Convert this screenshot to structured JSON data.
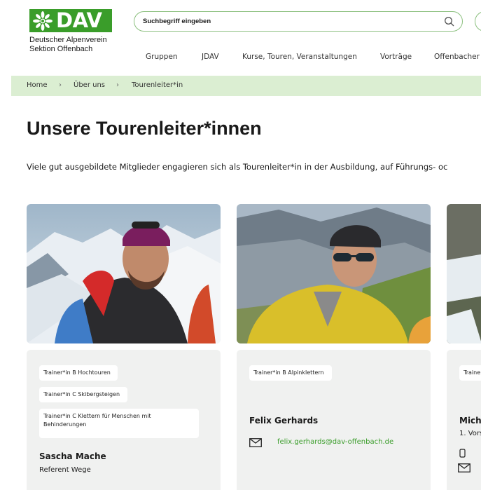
{
  "brand": {
    "logo_text": "DAV",
    "line1": "Deutscher Alpenverein",
    "line2": "Sektion Offenbach",
    "color": "#3a9d2a"
  },
  "search": {
    "placeholder": "Suchbegriff eingeben",
    "icon": "search-icon"
  },
  "nav": [
    "Gruppen",
    "JDAV",
    "Kurse, Touren, Veranstaltungen",
    "Vorträge",
    "Offenbacher"
  ],
  "breadcrumb": [
    "Home",
    "Über uns",
    "Tourenleiter*in"
  ],
  "page": {
    "title": "Unsere Tourenleiter*innen",
    "intro": "Viele gut ausgebildete Mitglieder engagieren sich als Tourenleiter*in in der Ausbildung, auf Führungs- oc"
  },
  "cards": [
    {
      "tags": [
        "Trainer*in B Hochtouren",
        "Trainer*in C Skibergsteigen",
        "Trainer*in C Klettern für Menschen mit",
        "Behinderungen"
      ],
      "name": "Sascha Mache",
      "role": "Referent Wege"
    },
    {
      "tags": [
        "Trainer*in B Alpinklettern"
      ],
      "name": "Felix Gerhards",
      "email": "felix.gerhards@dav-offenbach.de"
    },
    {
      "tags": [
        "Traine"
      ],
      "name": "Micha",
      "role": "1. Vors"
    }
  ]
}
